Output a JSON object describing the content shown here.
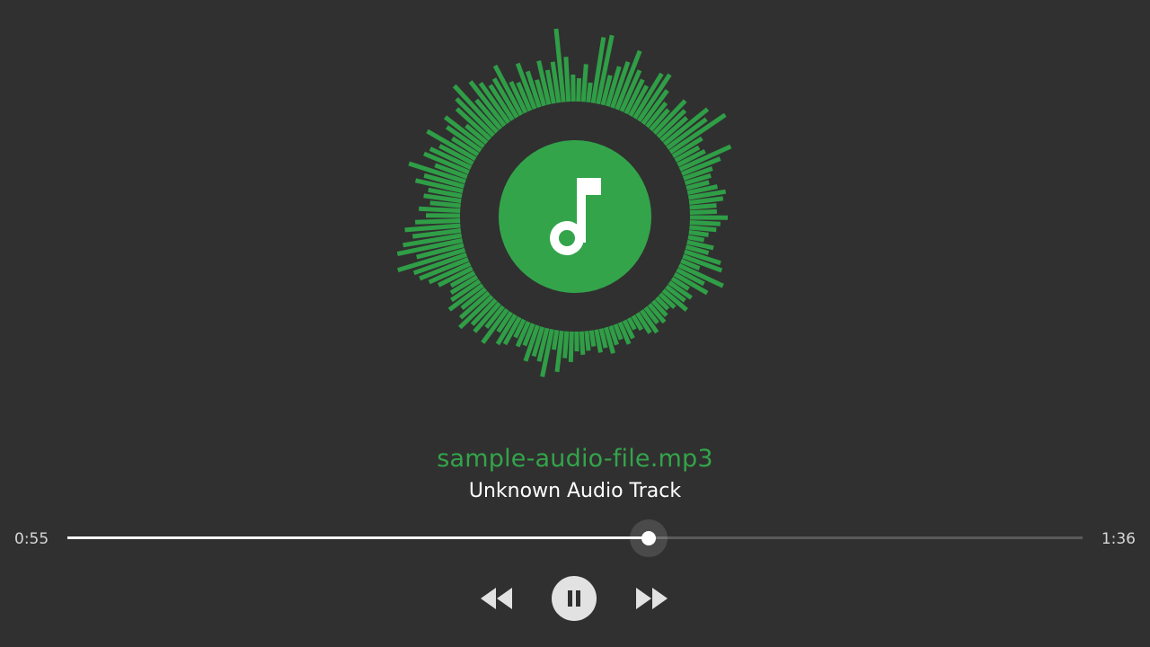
{
  "track": {
    "file_name": "sample-audio-file.mp3",
    "artist": "Unknown Audio Track"
  },
  "playback": {
    "elapsed": "0:55",
    "duration": "1:36",
    "progress_fraction": 0.5729,
    "state": "playing"
  },
  "controls": {
    "rewind_icon": "rewind-icon",
    "pause_icon": "pause-icon",
    "forward_icon": "fast-forward-icon"
  },
  "album_art": {
    "icon": "music-note-icon"
  },
  "colors": {
    "background": "#303030",
    "accent": "#33a44a",
    "visualizer": "#2f9e46",
    "text_primary": "#ffffff",
    "text_secondary": "#d6d6d6",
    "button": "#e2e2e2"
  },
  "visualizer": {
    "levels": [
      0.95,
      0.55,
      0.3,
      0.25,
      0.45,
      0.2,
      0.85,
      0.9,
      0.35,
      0.5,
      0.6,
      0.8,
      0.55,
      0.45,
      0.4,
      0.65,
      0.7,
      0.5,
      0.35,
      0.3,
      0.55,
      0.45,
      0.4,
      0.7,
      0.6,
      0.85,
      0.4,
      0.3,
      0.35,
      0.7,
      0.5,
      0.35,
      0.3,
      0.25,
      0.35,
      0.45,
      0.4,
      0.3,
      0.3,
      0.45,
      0.35,
      0.3,
      0.2,
      0.15,
      0.3,
      0.25,
      0.45,
      0.5,
      0.2,
      0.6,
      0.35,
      0.45,
      0.2,
      0.3,
      0.25,
      0.35,
      0.2,
      0.15,
      0.2,
      0.25,
      0.2,
      0.3,
      0.25,
      0.15,
      0.1,
      0.2,
      0.25,
      0.15,
      0.2,
      0.3,
      0.2,
      0.25,
      0.15,
      0.2,
      0.25,
      0.2,
      0.35,
      0.3,
      0.5,
      0.2,
      0.6,
      0.4,
      0.35,
      0.45,
      0.25,
      0.3,
      0.2,
      0.35,
      0.4,
      0.25,
      0.5,
      0.3,
      0.45,
      0.4,
      0.55,
      0.45,
      0.35,
      0.5,
      0.4,
      0.35,
      0.3,
      0.45,
      0.55,
      0.65,
      0.7,
      0.9,
      0.6,
      0.85,
      0.75,
      0.6,
      0.7,
      0.55,
      0.4,
      0.5,
      0.35,
      0.45,
      0.4,
      0.6,
      0.5,
      0.75,
      0.4,
      0.6,
      0.55,
      0.45,
      0.7,
      0.35,
      0.5,
      0.6,
      0.3,
      0.55,
      0.65,
      0.8,
      0.45,
      0.7,
      0.6,
      0.5,
      0.55,
      0.7,
      0.4,
      0.35,
      0.6,
      0.45,
      0.3,
      0.55,
      0.4,
      0.5
    ]
  }
}
